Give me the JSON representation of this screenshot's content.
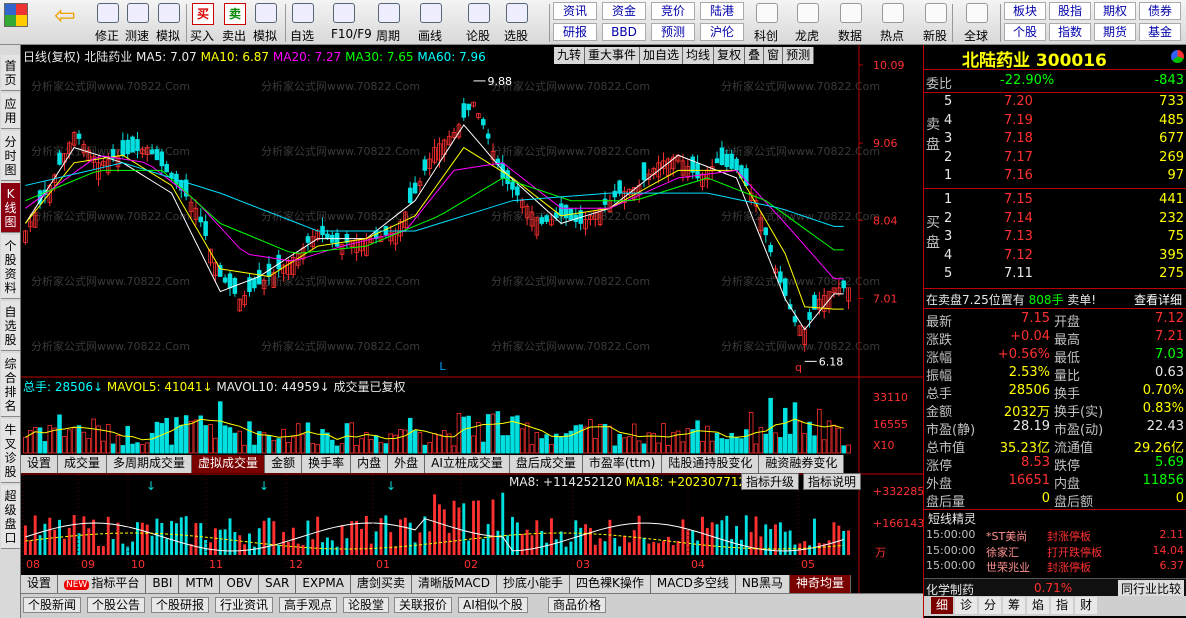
{
  "toolbar": {
    "items": [
      {
        "label": "",
        "icon": "grid-icon"
      },
      {
        "label": "",
        "icon": "back-arrow-icon"
      },
      {
        "label": "修正",
        "icon": "up-down-arrows-icon"
      },
      {
        "label": "测速",
        "icon": "stopwatch-icon"
      },
      {
        "label": "模拟",
        "icon": "clock-icon"
      },
      {
        "label": "买入",
        "icon": "buy-icon",
        "glyph": "买"
      },
      {
        "label": "卖出",
        "icon": "sell-icon",
        "glyph": "卖"
      },
      {
        "label": "模拟",
        "icon": "hammer-icon"
      },
      {
        "label": "自选",
        "icon": "star-icon"
      },
      {
        "label": "F10/F9",
        "icon": "f10-icon"
      },
      {
        "label": "周期",
        "icon": "cycle-icon"
      },
      {
        "label": "画线",
        "icon": "pencil-icon"
      },
      {
        "label": "论股",
        "icon": "discuss-icon"
      },
      {
        "label": "选股",
        "icon": "magnifier-icon"
      }
    ],
    "grid": [
      [
        "资讯",
        "资金",
        "竞价",
        "陆港"
      ],
      [
        "研报",
        "BBD",
        "预测",
        "沪伦"
      ]
    ],
    "items2": [
      {
        "label": "科创",
        "icon": "kechuang-icon"
      },
      {
        "label": "龙虎",
        "icon": "dragon-icon"
      },
      {
        "label": "数据",
        "icon": "pe-icon"
      },
      {
        "label": "热点",
        "icon": "hot-icon"
      },
      {
        "label": "新股",
        "icon": "ipo-icon"
      },
      {
        "label": "全球",
        "icon": "globe-icon"
      }
    ],
    "grid2": [
      [
        "板块",
        "股指",
        "期权",
        "债券"
      ],
      [
        "个股",
        "指数",
        "期货",
        "基金"
      ]
    ]
  },
  "leftbar": [
    "首页",
    "应用",
    "分时图",
    "K线图",
    "个股资料",
    "自选股",
    "综合排名",
    "牛叉诊股",
    "超级盘口"
  ],
  "chart_header": {
    "prefix": "日线(复权)",
    "name": "北陆药业",
    "ma5": "MA5: 7.07",
    "ma10": "MA10: 6.87",
    "ma20": "MA20: 7.27",
    "ma30": "MA30: 7.65",
    "ma60": "MA60: 7.96"
  },
  "chart_btns": [
    "九转",
    "重大事件",
    "加自选",
    "均线",
    "复权",
    "叠",
    "窗",
    "预测"
  ],
  "watermark": "分析家公式网www.70822.Com",
  "price_annot": {
    "high": "9.88",
    "low": "6.18",
    "l_marker": "L",
    "q_marker": "q"
  },
  "vol_header": {
    "total": "总手: 28506↓",
    "mavol5": "MAVOL5: 41041↓",
    "mavol10": "MAVOL10: 44959↓",
    "note": "成交量已复权"
  },
  "vol_axis": [
    "33110",
    "16555",
    "X10"
  ],
  "mid_tabs": [
    "设置",
    "成交量",
    "多周期成交量",
    "虚拟成交量",
    "金额",
    "换手率",
    "内盘",
    "外盘",
    "AI立桩成交量",
    "盘后成交量",
    "市盈率(ttm)",
    "陆股通持股变化",
    "融资融券变化"
  ],
  "ind_header": {
    "ma8": "MA8: +114252120",
    "ma18": "MA18: +202307712↓",
    "btn1": "指标升级",
    "btn2": "指标说明"
  },
  "ind_axis": [
    "+332285",
    "+166143",
    "万"
  ],
  "x_labels": [
    "08",
    "09",
    "10",
    "11",
    "12",
    "01",
    "02",
    "03",
    "04",
    "05"
  ],
  "bottom_tabs1": [
    "设置",
    "指标平台",
    "BBI",
    "MTM",
    "OBV",
    "SAR",
    "EXPMA",
    "唐剑买卖",
    "清晰版MACD",
    "抄底小能手",
    "四色裸K操作",
    "MACD多空线",
    "NB黑马",
    "神奇均量"
  ],
  "new_badge": "NEW",
  "bottom_tabs2": [
    "个股新闻",
    "个股公告",
    "个股研报",
    "行业资讯",
    "高手观点",
    "论股堂",
    "关联报价",
    "AI相似个股",
    "商品价格"
  ],
  "right": {
    "title": "北陆药业 300016",
    "weibi_label": "委比",
    "weibi": "-22.90%",
    "weicha": "-843",
    "sell_label": "卖盘",
    "buy_label": "买盘",
    "sell": [
      [
        "5",
        "7.20",
        "733"
      ],
      [
        "4",
        "7.19",
        "485"
      ],
      [
        "3",
        "7.18",
        "677"
      ],
      [
        "2",
        "7.17",
        "269"
      ],
      [
        "1",
        "7.16",
        "97"
      ]
    ],
    "buy": [
      [
        "1",
        "7.15",
        "441"
      ],
      [
        "2",
        "7.14",
        "232"
      ],
      [
        "3",
        "7.13",
        "75"
      ],
      [
        "4",
        "7.12",
        "395"
      ],
      [
        "5",
        "7.11",
        "275"
      ]
    ],
    "notice": "在卖盘7.25位置有",
    "notice_vol": "808手",
    "notice_tail": "卖单!",
    "detail": "查看详细",
    "stats": [
      [
        "最新",
        "7.15",
        "开盘",
        "7.12"
      ],
      [
        "涨跌",
        "+0.04",
        "最高",
        "7.21"
      ],
      [
        "涨幅",
        "+0.56%",
        "最低",
        "7.03"
      ],
      [
        "振幅",
        "2.53%",
        "量比",
        "0.63"
      ],
      [
        "总手",
        "28506",
        "换手",
        "0.70%"
      ],
      [
        "金额",
        "2032万",
        "换手(实)",
        "0.83%"
      ],
      [
        "市盈(静)",
        "28.19",
        "市盈(动)",
        "22.43"
      ],
      [
        "总市值",
        "35.23亿",
        "流通值",
        "29.26亿"
      ],
      [
        "涨停",
        "8.53",
        "跌停",
        "5.69"
      ],
      [
        "外盘",
        "16651",
        "内盘",
        "11856"
      ],
      [
        "盘后量",
        "0",
        "盘后额",
        "0"
      ]
    ],
    "elf_title": "短线精灵",
    "elf": [
      [
        "15:00:00",
        "*ST美尚",
        "封涨停板",
        "2.11"
      ],
      [
        "15:00:00",
        "徐家汇",
        "打开跌停板",
        "14.04"
      ],
      [
        "15:00:00",
        "世荣兆业",
        "封涨停板",
        "6.37"
      ]
    ],
    "sector": "化学制药",
    "sector_pct": "0.71%",
    "compare": "同行业比较",
    "btabs": [
      "细",
      "诊",
      "分",
      "筹",
      "焰",
      "指",
      "财"
    ]
  },
  "colors": {
    "up": "#ff3030",
    "down": "#00e0e0",
    "ma5": "#ffffff",
    "ma10": "#ffff00",
    "ma20": "#ff00ff",
    "ma30": "#00ff00",
    "ma60": "#00e0ff"
  },
  "chart_data": {
    "type": "candlestick",
    "title": "北陆药业 日线(复权)",
    "price_ylim": [
      6.0,
      10.09
    ],
    "price_ticks": [
      "10.09",
      "9.06",
      "8.04",
      "7.01"
    ],
    "high_marker": 9.88,
    "low_marker": 6.18,
    "x_month_labels": [
      "08",
      "09",
      "10",
      "11",
      "12",
      "01",
      "02",
      "03",
      "04",
      "05"
    ],
    "close_path": [
      [
        0,
        7.9
      ],
      [
        5,
        8.5
      ],
      [
        10,
        9.2
      ],
      [
        15,
        8.8
      ],
      [
        20,
        8.9
      ],
      [
        25,
        9.0
      ],
      [
        30,
        8.6
      ],
      [
        35,
        8.2
      ],
      [
        40,
        7.3
      ],
      [
        44,
        7.0
      ],
      [
        48,
        7.2
      ],
      [
        52,
        7.4
      ],
      [
        56,
        7.6
      ],
      [
        60,
        7.9
      ],
      [
        64,
        7.7
      ],
      [
        68,
        7.8
      ],
      [
        72,
        7.8
      ],
      [
        76,
        7.9
      ],
      [
        80,
        8.4
      ],
      [
        84,
        9.0
      ],
      [
        88,
        9.2
      ],
      [
        92,
        9.6
      ],
      [
        94,
        9.3
      ],
      [
        98,
        8.6
      ],
      [
        102,
        8.3
      ],
      [
        106,
        8.0
      ],
      [
        110,
        8.1
      ],
      [
        114,
        8.0
      ],
      [
        118,
        8.2
      ],
      [
        122,
        8.4
      ],
      [
        126,
        8.5
      ],
      [
        130,
        8.8
      ],
      [
        134,
        8.9
      ],
      [
        138,
        8.6
      ],
      [
        142,
        8.8
      ],
      [
        146,
        8.7
      ],
      [
        150,
        8.3
      ],
      [
        154,
        7.4
      ],
      [
        158,
        6.7
      ],
      [
        160,
        6.6
      ],
      [
        163,
        7.0
      ],
      [
        166,
        7.15
      ]
    ],
    "ma_lines": {
      "ma5": [
        [
          0,
          8.0
        ],
        [
          10,
          9.0
        ],
        [
          20,
          8.8
        ],
        [
          30,
          8.4
        ],
        [
          40,
          7.1
        ],
        [
          48,
          7.3
        ],
        [
          60,
          7.8
        ],
        [
          70,
          7.8
        ],
        [
          80,
          8.3
        ],
        [
          90,
          9.3
        ],
        [
          98,
          8.7
        ],
        [
          110,
          8.0
        ],
        [
          120,
          8.2
        ],
        [
          134,
          8.9
        ],
        [
          146,
          8.6
        ],
        [
          156,
          7.0
        ],
        [
          160,
          6.6
        ],
        [
          166,
          7.07
        ]
      ],
      "ma10": [
        [
          0,
          8.0
        ],
        [
          10,
          8.8
        ],
        [
          20,
          8.9
        ],
        [
          30,
          8.5
        ],
        [
          40,
          7.4
        ],
        [
          50,
          7.3
        ],
        [
          60,
          7.7
        ],
        [
          70,
          7.8
        ],
        [
          80,
          8.1
        ],
        [
          90,
          9.0
        ],
        [
          100,
          8.6
        ],
        [
          110,
          8.1
        ],
        [
          120,
          8.2
        ],
        [
          134,
          8.7
        ],
        [
          146,
          8.7
        ],
        [
          156,
          7.6
        ],
        [
          160,
          6.9
        ],
        [
          166,
          6.87
        ]
      ],
      "ma20": [
        [
          0,
          8.2
        ],
        [
          15,
          8.9
        ],
        [
          25,
          8.8
        ],
        [
          35,
          8.3
        ],
        [
          45,
          7.6
        ],
        [
          55,
          7.5
        ],
        [
          65,
          7.7
        ],
        [
          78,
          7.9
        ],
        [
          88,
          8.7
        ],
        [
          98,
          8.8
        ],
        [
          110,
          8.2
        ],
        [
          120,
          8.2
        ],
        [
          134,
          8.6
        ],
        [
          146,
          8.7
        ],
        [
          156,
          8.0
        ],
        [
          166,
          7.27
        ]
      ],
      "ma30": [
        [
          0,
          8.3
        ],
        [
          15,
          8.7
        ],
        [
          28,
          8.7
        ],
        [
          40,
          8.0
        ],
        [
          55,
          7.6
        ],
        [
          70,
          7.7
        ],
        [
          85,
          8.1
        ],
        [
          98,
          8.6
        ],
        [
          112,
          8.3
        ],
        [
          125,
          8.3
        ],
        [
          140,
          8.6
        ],
        [
          152,
          8.3
        ],
        [
          166,
          7.65
        ]
      ],
      "ma60": [
        [
          0,
          8.5
        ],
        [
          20,
          8.8
        ],
        [
          40,
          8.4
        ],
        [
          60,
          7.9
        ],
        [
          80,
          7.9
        ],
        [
          100,
          8.3
        ],
        [
          120,
          8.4
        ],
        [
          140,
          8.4
        ],
        [
          155,
          8.2
        ],
        [
          166,
          7.96
        ]
      ]
    },
    "volume_ylim": [
      0,
      33110
    ],
    "volume_ticks": [
      "33110",
      "16555",
      "X10"
    ],
    "indicator_ticks": [
      "+332285",
      "+166143"
    ],
    "indicator_label": "万"
  }
}
